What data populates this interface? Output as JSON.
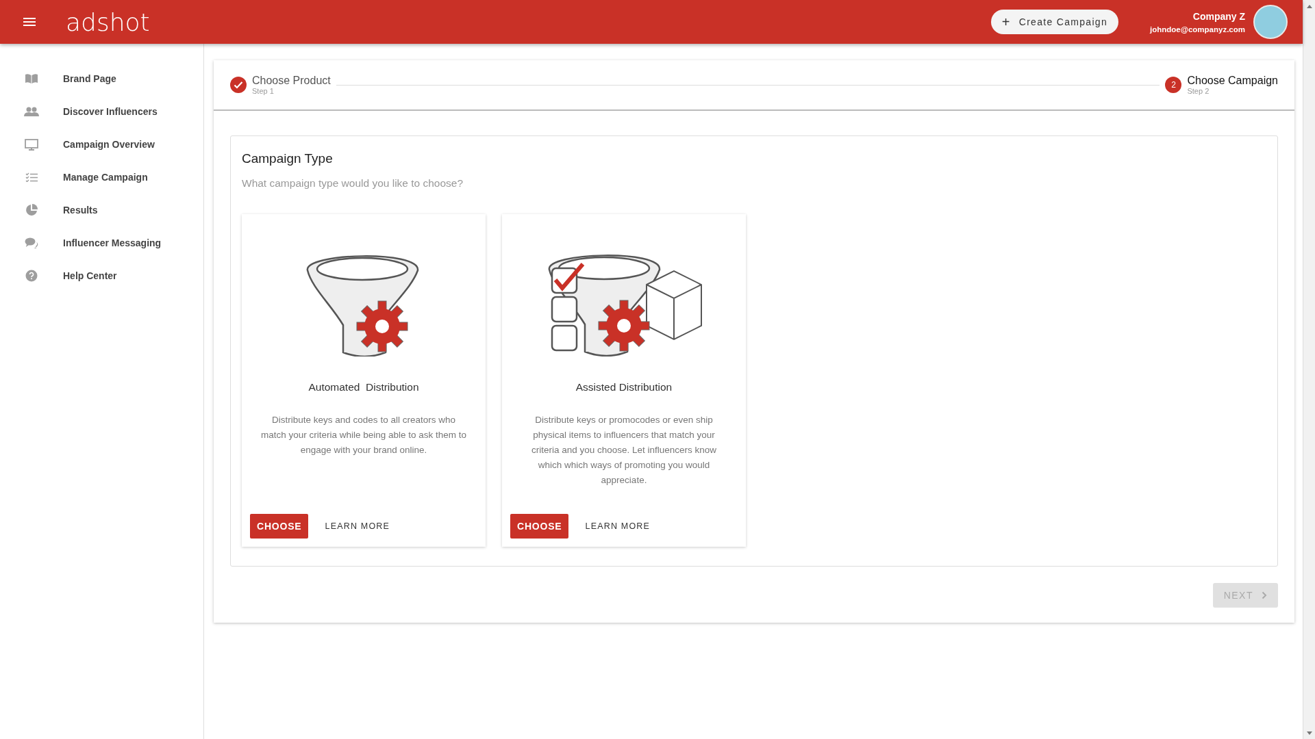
{
  "header": {
    "logo": "adshot",
    "create_button": {
      "icon": "+",
      "label": "Create Campaign"
    },
    "user": {
      "name": "Company Z",
      "email": "johndoe@companyz.com"
    }
  },
  "sidebar": {
    "items": [
      {
        "label": "Brand Page",
        "selected": false
      },
      {
        "label": "Discover Influencers",
        "selected": false
      },
      {
        "label": "Campaign Overview",
        "selected": false
      },
      {
        "label": "Manage Campaign",
        "selected": false
      },
      {
        "label": "Results",
        "selected": false
      },
      {
        "label": "Influencer Messaging",
        "selected": false
      },
      {
        "label": "Help Center",
        "selected": false
      }
    ]
  },
  "stepper": {
    "steps": [
      {
        "title": "Choose Product",
        "subtitle": "Step 1",
        "completed": true,
        "selected": false
      },
      {
        "number": "2",
        "title": "Choose Campaign",
        "subtitle": "Step 2",
        "completed": false,
        "selected": true
      }
    ]
  },
  "campaign_type": {
    "title": "Campaign Type",
    "subtitle": "What campaign type would you like to choose?",
    "options": [
      {
        "title": "Automated  Distribution",
        "description": "Distribute keys and codes to all creators who match your criteria while being able to ask them to engage with your brand online.",
        "choose": "CHOOSE",
        "learn_more": "LEARN MORE"
      },
      {
        "title": "Assisted Distribution",
        "description": "Distribute keys or promocodes or even ship physical items to influencers that match your criteria and you choose. Let influencers know which which ways of promoting you would appreciate.",
        "choose": "CHOOSE",
        "learn_more": "LEARN MORE"
      }
    ]
  },
  "next_button": {
    "label": "NEXT",
    "disabled": true
  }
}
